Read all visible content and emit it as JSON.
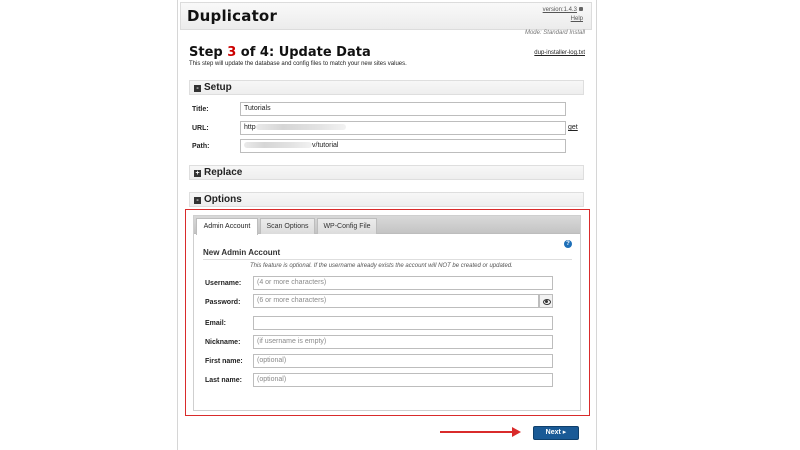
{
  "header": {
    "brand": "Duplicator",
    "version": "version:1.4.3",
    "help": "Help",
    "mode": "Mode: Standard Install"
  },
  "step": {
    "prefix": "Step ",
    "num": "3",
    "suffix": " of 4: Update Data",
    "description": "This step will update the database and config files to match your new sites values.",
    "log_link": "dup-installer-log.txt"
  },
  "sections": {
    "setup": {
      "toggle": "-",
      "label": "Setup"
    },
    "replace": {
      "toggle": "+",
      "label": "Replace"
    },
    "options": {
      "toggle": "-",
      "label": "Options"
    }
  },
  "setup": {
    "title_label": "Title:",
    "title_value": "Tutorials",
    "url_label": "URL:",
    "url_value_prefix": "http",
    "get_link": "get",
    "path_label": "Path:",
    "path_value_suffix": "v/tutorial"
  },
  "tabs": [
    {
      "label": "Admin Account",
      "active": true
    },
    {
      "label": "Scan Options",
      "active": false
    },
    {
      "label": "WP-Config File",
      "active": false
    }
  ],
  "admin": {
    "heading": "New Admin Account",
    "help_icon": "?",
    "note": "This feature is optional. If the username already exists the account will NOT be created or updated.",
    "fields": [
      {
        "label": "Username:",
        "placeholder": "(4 or more characters)"
      },
      {
        "label": "Password:",
        "placeholder": "(6 or more characters)"
      },
      {
        "label": "Email:",
        "placeholder": ""
      },
      {
        "label": "Nickname:",
        "placeholder": "(if username is empty)"
      },
      {
        "label": "First name:",
        "placeholder": "(optional)"
      },
      {
        "label": "Last name:",
        "placeholder": "(optional)"
      }
    ]
  },
  "footer": {
    "next_label": "Next ▸"
  },
  "colors": {
    "accent_red": "#cc0000",
    "highlight_red": "#d92b2b",
    "button_blue": "#1a5a96"
  }
}
